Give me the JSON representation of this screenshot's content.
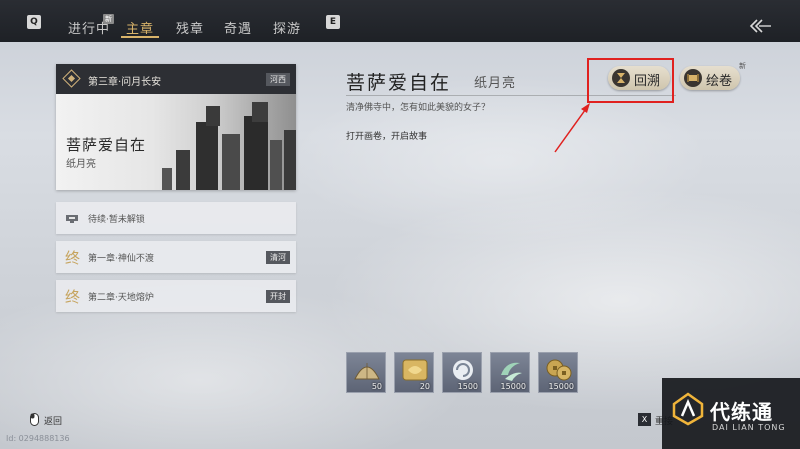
{
  "topbar": {
    "left_key": "Q",
    "right_key": "E",
    "tabs": [
      {
        "label": "进行中",
        "active": false
      },
      {
        "label": "主章",
        "active": true
      },
      {
        "label": "残章",
        "active": false
      },
      {
        "label": "奇遇",
        "active": false
      },
      {
        "label": "探游",
        "active": false
      }
    ],
    "new_badge": "新",
    "back_icon": "double-chevron-left-icon"
  },
  "chapter": {
    "title": "第三章·问月长安",
    "place": "河西",
    "scene_title": "菩萨爱自在",
    "scene_sub": "纸月亮"
  },
  "list": [
    {
      "label": "待续·暂未解锁",
      "tag": "",
      "icon": "lock-icon"
    },
    {
      "label": "第一章·神仙不渡",
      "tag": "清河",
      "icon": "seal-glyph-icon"
    },
    {
      "label": "第二章·天地熔炉",
      "tag": "开封",
      "icon": "seal-glyph-icon"
    }
  ],
  "detail": {
    "title": "菩萨爱自在",
    "author": "纸月亮",
    "quote": "清净佛寺中，怎有如此美貌的女子？",
    "hint": "打开画卷，开启故事"
  },
  "actions": {
    "recall_label": "回溯",
    "scroll_label": "绘卷",
    "scroll_badge": "新"
  },
  "rewards": [
    {
      "icon": "fan-icon",
      "count": "50"
    },
    {
      "icon": "gold-token-icon",
      "count": "20"
    },
    {
      "icon": "swirl-orb-icon",
      "count": "1500"
    },
    {
      "icon": "jade-wave-icon",
      "count": "15000"
    },
    {
      "icon": "coins-icon",
      "count": "15000"
    }
  ],
  "bottom": {
    "back_label": "返回",
    "uid": "Id: 0294888136",
    "reset_key": "X",
    "reset_label": "重接"
  },
  "watermark": {
    "name": "代练通",
    "pinyin": "DAI LIAN TONG"
  },
  "colors": {
    "accent": "#d8b36a",
    "highlight": "#e0211f",
    "topbar": "#1e2126"
  }
}
